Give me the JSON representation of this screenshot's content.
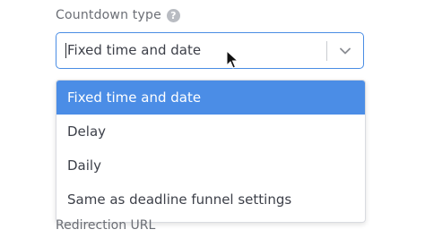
{
  "countdown": {
    "label": "Countdown type",
    "help_icon_text": "?",
    "selected_value": "Fixed time and date",
    "options": [
      {
        "label": "Fixed time and date",
        "selected": true
      },
      {
        "label": "Delay",
        "selected": false
      },
      {
        "label": "Daily",
        "selected": false
      },
      {
        "label": "Same as deadline funnel settings",
        "selected": false
      }
    ]
  },
  "redirection": {
    "label": "Redirection URL"
  },
  "colors": {
    "accent": "#4b8de6",
    "focus_border": "#4a8de4",
    "label_text": "#6b6e75",
    "body_text": "#3d4049"
  },
  "icons": {
    "help": "question-circle-icon",
    "chevron": "chevron-down-icon",
    "cursor": "mouse-pointer-icon"
  }
}
